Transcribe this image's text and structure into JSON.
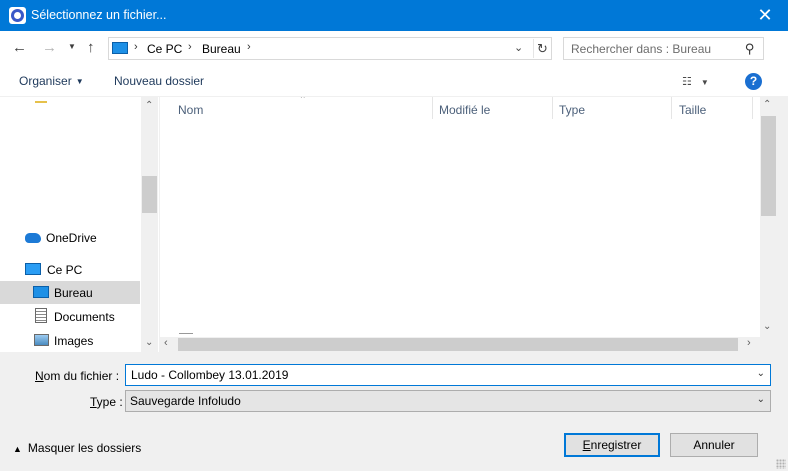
{
  "window": {
    "title": "Sélectionnez un fichier..."
  },
  "navbar": {
    "breadcrumb": [
      "Ce PC",
      "Bureau"
    ],
    "search_placeholder": "Rechercher dans : Bureau"
  },
  "toolbar": {
    "organize": "Organiser",
    "new_folder": "Nouveau dossier",
    "help": "?"
  },
  "sidebar": {
    "items": [
      {
        "label": "OneDrive",
        "icon": "onedrive-icon"
      },
      {
        "label": "Ce PC",
        "icon": "pc-icon"
      },
      {
        "label": "Bureau",
        "icon": "desktop-folder-icon",
        "selected": true
      },
      {
        "label": "Documents",
        "icon": "documents-icon"
      },
      {
        "label": "Images",
        "icon": "pictures-icon"
      }
    ]
  },
  "file_list": {
    "columns": [
      "Nom",
      "Modifié le",
      "Type",
      "Taille"
    ],
    "rows": []
  },
  "form": {
    "filename_label_u": "N",
    "filename_label_rest": "om du fichier :",
    "filename_value": "Ludo - Collombey 13.01.2019",
    "type_label_u": "T",
    "type_label_rest": "ype :",
    "type_value": "Sauvegarde Infoludo"
  },
  "footer": {
    "hide_folders": "Masquer les dossiers",
    "save_u": "E",
    "save_rest": "nregistrer",
    "cancel": "Annuler"
  },
  "colors": {
    "accent": "#0078d7",
    "selected": "#d9d9d9"
  }
}
